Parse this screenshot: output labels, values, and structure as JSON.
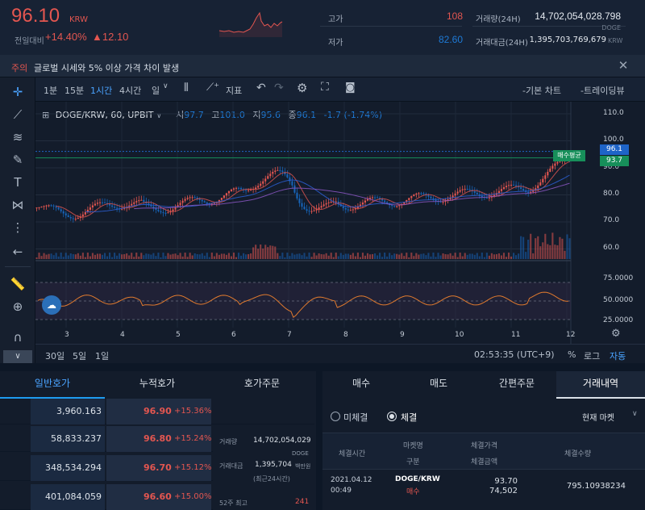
{
  "header": {
    "price": "96.10",
    "currency": "KRW",
    "prev_label": "전일대비",
    "change_pct": "+14.40%",
    "change_abs": "▲12.10",
    "high_label": "고가",
    "high_value": "108",
    "low_label": "저가",
    "low_value": "82.60",
    "volume_label": "거래량(24H)",
    "volume_value": "14,702,054,028.798",
    "volume_unit": "DOGE",
    "amount_label": "거래대금(24H)",
    "amount_value": "1,395,703,769,679",
    "amount_unit": "KRW"
  },
  "notice": {
    "badge": "주의",
    "text": "글로벌 시세와 5% 이상 가격 차이 발생",
    "close_icon": "close-icon"
  },
  "toolbar": {
    "intervals": [
      "1분",
      "15분",
      "1시간",
      "4시간",
      "일"
    ],
    "active_interval": "1시간",
    "indicator_label": "지표",
    "basic_chart": "-기본 차트",
    "tradingview": "-트레이딩뷰"
  },
  "chart_legend": {
    "symbol": "DOGE/KRW, 60, UPBIT",
    "open_label": "시",
    "open": "97.7",
    "high_label": "고",
    "high": "101.0",
    "low_label": "저",
    "low": "95.6",
    "close_label": "종",
    "close": "96.1",
    "change": "-1.7 (-1.74%)"
  },
  "price_axis": {
    "ticks": [
      "110.0",
      "100.0",
      "90.0",
      "80.0",
      "70.0",
      "60.0"
    ],
    "current_label": "96.1",
    "avg_label": "93.7",
    "avg_marker": "매수평균",
    "rsi_ticks": [
      "75.0000",
      "50.0000",
      "25.0000"
    ]
  },
  "time_axis": [
    "3",
    "4",
    "5",
    "6",
    "7",
    "8",
    "9",
    "10",
    "11",
    "12"
  ],
  "bottom_bar": {
    "ranges": [
      "30일",
      "5일",
      "1일"
    ],
    "time": "02:53:35 (UTC+9)",
    "pct": "%",
    "log": "로그",
    "auto": "자동"
  },
  "orderbook": {
    "tabs": [
      "일반호가",
      "누적호가",
      "호가주문"
    ],
    "rows": [
      {
        "vol": "3,960.163",
        "price": "96.90",
        "pct": "+15.36%"
      },
      {
        "vol": "58,833.237",
        "price": "96.80",
        "pct": "+15.24%"
      },
      {
        "vol": "348,534.294",
        "price": "96.70",
        "pct": "+15.12%"
      },
      {
        "vol": "401,084.059",
        "price": "96.60",
        "pct": "+15.00%"
      }
    ],
    "info": {
      "vol_label": "거래량",
      "vol_value": "14,702,054,029",
      "vol_unit": "DOGE",
      "amt_label": "거래대금",
      "amt_value": "1,395,704",
      "amt_unit": "백만원",
      "amt_note": "(최근24시간)",
      "high52_label": "52주 최고",
      "high52_value": "241"
    }
  },
  "trade": {
    "tabs": [
      "매수",
      "매도",
      "간편주문",
      "거래내역"
    ],
    "active_tab": "거래내역",
    "radio_unfilled": "미체결",
    "radio_filled": "체결",
    "market_select": "현재 마켓",
    "cols": {
      "time": "체결시간",
      "market": "마켓명",
      "type": "구분",
      "price": "체결가격",
      "amount": "체결금액",
      "qty": "체결수량"
    },
    "row": {
      "date": "2021.04.12",
      "time": "00:49",
      "market": "DOGE/KRW",
      "type": "매수",
      "price": "93.70",
      "amount": "74,502",
      "qty": "795.10938234"
    }
  },
  "colors": {
    "up": "#e35650",
    "down": "#1763b6",
    "accent": "#1e9bf0",
    "bg": "#131c2b"
  }
}
